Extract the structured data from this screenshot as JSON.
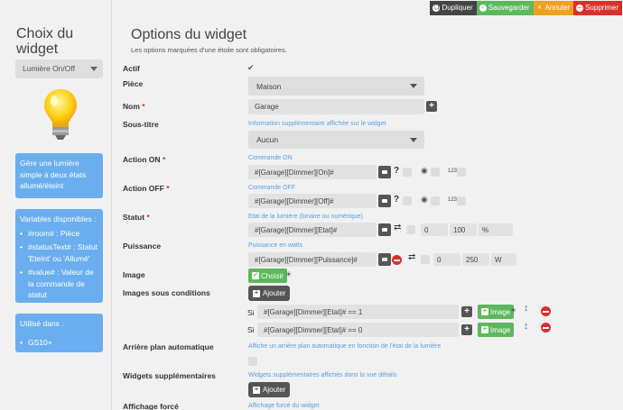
{
  "sidebar": {
    "title": "Choix du widget",
    "selected_widget": "Lumière On/Off",
    "description": "Gère une lumière simple à deux états allumé/éteint",
    "variables_title": "Variables disponibles :",
    "variables": [
      "#room# : Pièce",
      "#statusText# : Statut 'Eteint' ou 'Allumé'",
      "#value# : Valeur de la commande de statut"
    ],
    "used_in_title": "Utilisé dans :",
    "used_in": [
      "GS10+"
    ]
  },
  "toolbar": {
    "duplicate": "Dupliquer",
    "save": "Sauvegarder",
    "cancel": "Annuler",
    "delete": "Supprimer"
  },
  "main": {
    "title": "Options du widget",
    "subtitle": "Les options marquées d'une étoile sont obligatoires.",
    "actif_label": "Actif",
    "piece_label": "Pièce",
    "piece_value": "Maison",
    "nom_label": "Nom",
    "nom_value": "Garage",
    "soustitre_label": "Sous-titre",
    "soustitre_help": "Information supplémentaire affichée sur le widget",
    "soustitre_value": "Aucun",
    "actionon_label": "Action ON",
    "actionon_help": "Commande ON",
    "actionon_value": "#[Garage][Dimmer][On]#",
    "actionoff_label": "Action OFF",
    "actionoff_help": "Commande OFF",
    "actionoff_value": "#[Garage][Dimmer][Off]#",
    "statut_label": "Statut",
    "statut_help": "Etat de la lumière (binaire ou numérique)",
    "statut_value": "#[Garage][Dimmer][Etat]#",
    "statut_min": "0",
    "statut_max": "100",
    "statut_unit": "%",
    "puissance_label": "Puissance",
    "puissance_help": "Puissance en watts",
    "puissance_value": "#[Garage][Dimmer][Puissance]#",
    "puissance_min": "0",
    "puissance_max": "250",
    "puissance_unit": "W",
    "image_label": "Image",
    "image_button": "Choisir",
    "images_cond_label": "Images sous conditions",
    "add_button": "Ajouter",
    "si": "Si",
    "cond1": "#[Garage][Dimmer][Etat]# == 1",
    "cond2": "#[Garage][Dimmer][Etat]# == 0",
    "cond_image_button": "Image",
    "cond2_suffix": ".",
    "arriere_label": "Arrière plan automatique",
    "arriere_help": "Affiche un arrière plan automatique en fonction de l'état de la lumière",
    "widgets_sup_label": "Widgets supplémentaires",
    "widgets_sup_help": "Widgets supplémentaires affichés dans la vue détails",
    "affichage_label": "Affichage forcé",
    "affichage_help": "Affichage forcé du widget",
    "required_star": "*",
    "qmark": "?",
    "small_123": "123"
  }
}
